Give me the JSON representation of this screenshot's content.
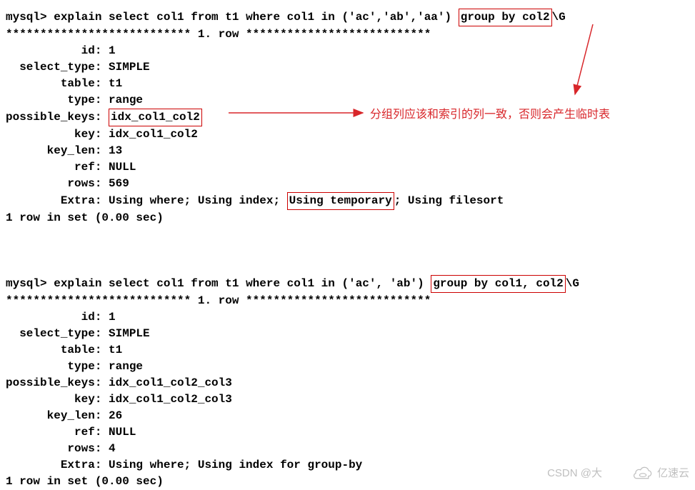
{
  "query1": {
    "prompt": "mysql> ",
    "command_prefix": "explain select col1 from t1 where col1 in ('ac','ab','aa') ",
    "command_boxed": "group by col2",
    "command_suffix": "\\G",
    "divider": "*************************** 1. row ***************************",
    "fields": {
      "id": "           id: 1",
      "select_type": "  select_type: SIMPLE",
      "table": "        table: t1",
      "type": "         type: range",
      "possible_keys_label": "possible_keys: ",
      "possible_keys_value": "idx_col1_col2",
      "key": "          key: idx_col1_col2",
      "key_len": "      key_len: 13",
      "ref": "          ref: NULL",
      "rows": "         rows: 569",
      "extra_prefix": "        Extra: Using where; Using index; ",
      "extra_boxed": "Using temporary",
      "extra_suffix": "; Using filesort"
    },
    "footer": "1 row in set (0.00 sec)"
  },
  "query2": {
    "prompt": "mysql> ",
    "command_prefix": "explain select col1 from t1 where col1 in ('ac', 'ab') ",
    "command_boxed": "group by col1, col2",
    "command_suffix": "\\G",
    "divider": "*************************** 1. row ***************************",
    "fields": {
      "id": "           id: 1",
      "select_type": "  select_type: SIMPLE",
      "table": "        table: t1",
      "type": "         type: range",
      "possible_keys": "possible_keys: idx_col1_col2_col3",
      "key": "          key: idx_col1_col2_col3",
      "key_len": "      key_len: 26",
      "ref": "          ref: NULL",
      "rows": "         rows: 4",
      "extra": "        Extra: Using where; Using index for group-by"
    },
    "footer": "1 row in set (0.00 sec)"
  },
  "annotation": {
    "text": "分组列应该和索引的列一致，否则会产生临时表"
  },
  "watermark": {
    "left": "CSDN @大",
    "right": "亿速云"
  }
}
